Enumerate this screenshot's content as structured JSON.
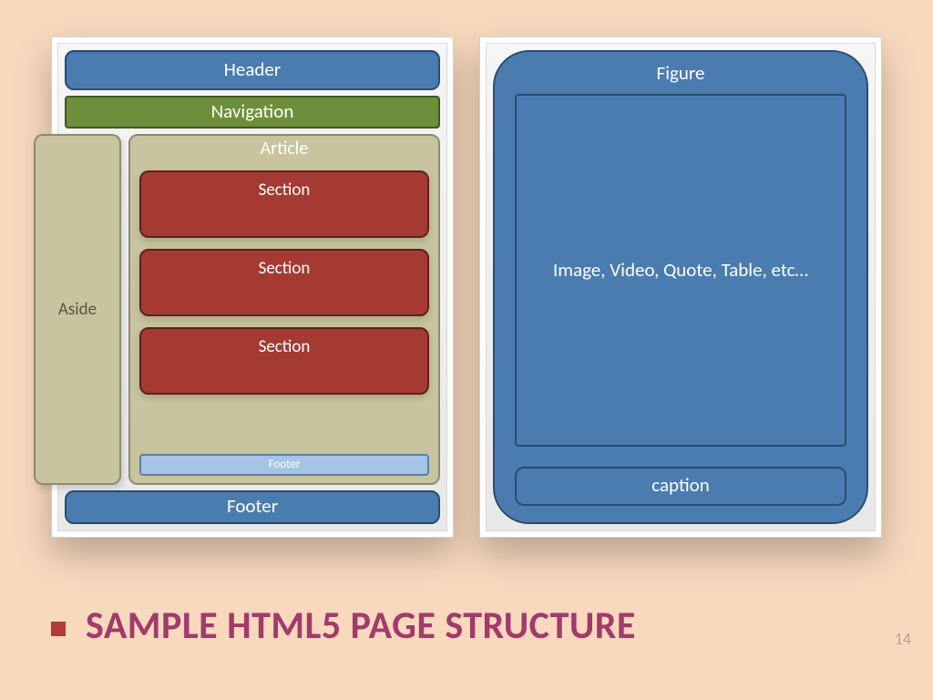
{
  "left_panel": {
    "header": "Header",
    "navigation": "Navigation",
    "aside": "Aside",
    "article_title": "Article",
    "sections": [
      "Section",
      "Section",
      "Section"
    ],
    "inner_footer": "Footer",
    "outer_footer": "Footer"
  },
  "right_panel": {
    "figure_title": "Figure",
    "content": "Image, Video, Quote, Table, etc…",
    "caption": "caption"
  },
  "title": "SAMPLE HTML5 PAGE STRUCTURE",
  "page_number": "14",
  "colors": {
    "bg": "#f8d9be",
    "blue": "#4a7cb0",
    "green": "#6d8f3b",
    "tan": "#c8c49f",
    "red": "#a43a32",
    "lightblue": "#a6c4e6",
    "title_color": "#a23a6b"
  }
}
